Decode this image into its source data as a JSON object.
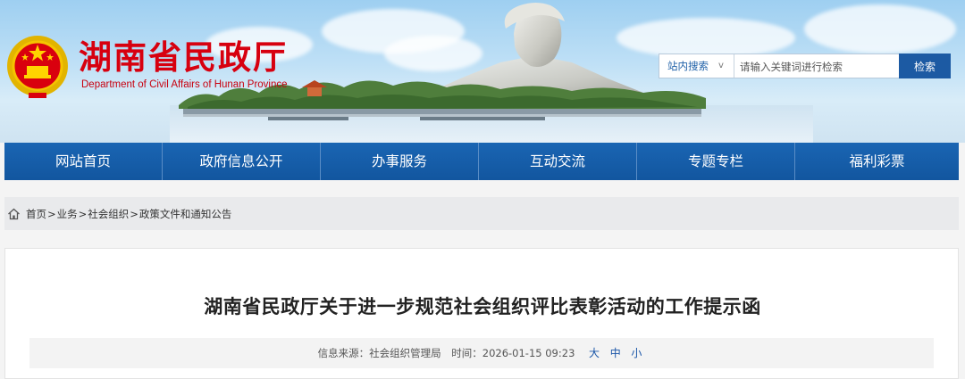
{
  "header": {
    "title": "湖南省民政厅",
    "subtitle": "Department of Civil Affairs of Hunan Province"
  },
  "search": {
    "scope_label": "站内搜索",
    "scope_chevron": "v",
    "placeholder": "请输入关键词进行检索",
    "button_label": "检索"
  },
  "nav": {
    "items": [
      {
        "label": "网站首页"
      },
      {
        "label": "政府信息公开"
      },
      {
        "label": "办事服务"
      },
      {
        "label": "互动交流"
      },
      {
        "label": "专题专栏"
      },
      {
        "label": "福利彩票"
      }
    ]
  },
  "breadcrumb": {
    "items": [
      "首页",
      "业务",
      "社会组织",
      "政策文件和通知公告"
    ],
    "separator": ">"
  },
  "article": {
    "title": "湖南省民政厅关于进一步规范社会组织评比表彰活动的工作提示函",
    "source_label": "信息来源：",
    "source_value": "社会组织管理局",
    "time_label": "时间：",
    "time_value": "2026-01-15 09:23",
    "font_sizes": [
      "大",
      "中",
      "小"
    ]
  },
  "colors": {
    "brand_red": "#d7000f",
    "nav_blue": "#12569f",
    "search_button": "#1c5aa3",
    "link_blue": "#1a56a8"
  }
}
